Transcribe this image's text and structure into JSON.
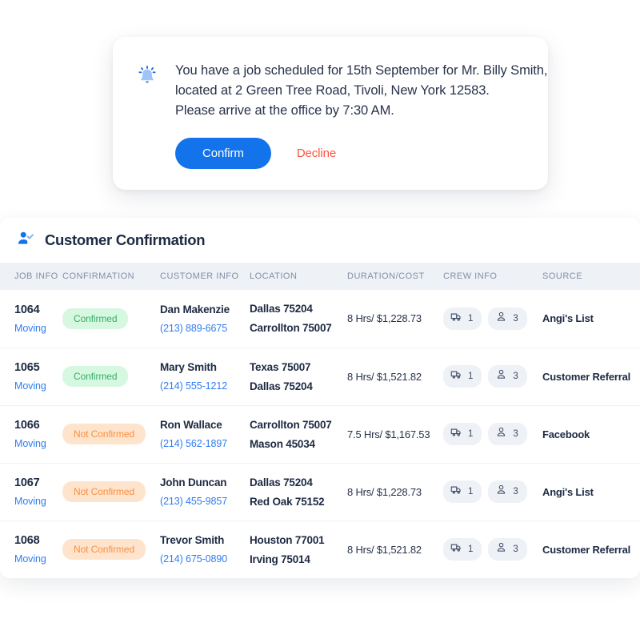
{
  "notification": {
    "icon": "bell-icon",
    "lines": [
      "You have a job scheduled for 15th September for Mr. Billy Smith,",
      "located at 2 Green Tree Road, Tivoli, New York 12583.",
      "Please arrive at the office by 7:30 AM."
    ],
    "confirm_label": "Confirm",
    "decline_label": "Decline",
    "confirm_color": "#1273eb",
    "decline_color": "#f9553e"
  },
  "table": {
    "icon": "user-check-icon",
    "title": "Customer Confirmation",
    "columns": [
      "JOB INFO",
      "CONFIRMATION",
      "CUSTOMER INFO",
      "LOCATION",
      "DURATION/COST",
      "CREW INFO",
      "SOURCE"
    ],
    "rows": [
      {
        "job_id": "1064",
        "job_type": "Moving",
        "confirmation": "Confirmed",
        "confirmation_state": "confirmed",
        "customer_name": "Dan Makenzie",
        "customer_phone": "(213) 889-6675",
        "location_1": "Dallas 75204",
        "location_2": "Carrollton 75007",
        "duration_cost": "8 Hrs/ $1,228.73",
        "trucks": "1",
        "crew": "3",
        "source": "Angi's List"
      },
      {
        "job_id": "1065",
        "job_type": "Moving",
        "confirmation": "Confirmed",
        "confirmation_state": "confirmed",
        "customer_name": "Mary Smith",
        "customer_phone": "(214) 555-1212",
        "location_1": "Texas 75007",
        "location_2": "Dallas 75204",
        "duration_cost": "8 Hrs/ $1,521.82",
        "trucks": "1",
        "crew": "3",
        "source": "Customer Referral"
      },
      {
        "job_id": "1066",
        "job_type": "Moving",
        "confirmation": "Not Confirmed",
        "confirmation_state": "not-confirmed",
        "customer_name": "Ron Wallace",
        "customer_phone": "(214) 562-1897",
        "location_1": "Carrollton 75007",
        "location_2": "Mason 45034",
        "duration_cost": "7.5 Hrs/ $1,167.53",
        "trucks": "1",
        "crew": "3",
        "source": "Facebook"
      },
      {
        "job_id": "1067",
        "job_type": "Moving",
        "confirmation": "Not Confirmed",
        "confirmation_state": "not-confirmed",
        "customer_name": "John Duncan",
        "customer_phone": "(213) 455-9857",
        "location_1": "Dallas 75204",
        "location_2": "Red Oak 75152",
        "duration_cost": "8 Hrs/ $1,228.73",
        "trucks": "1",
        "crew": "3",
        "source": "Angi's List"
      },
      {
        "job_id": "1068",
        "job_type": "Moving",
        "confirmation": "Not Confirmed",
        "confirmation_state": "not-confirmed",
        "customer_name": "Trevor Smith",
        "customer_phone": "(214) 675-0890",
        "location_1": "Houston 77001",
        "location_2": "Irving 75014",
        "duration_cost": "8 Hrs/ $1,521.82",
        "trucks": "1",
        "crew": "3",
        "source": "Customer Referral"
      }
    ]
  }
}
